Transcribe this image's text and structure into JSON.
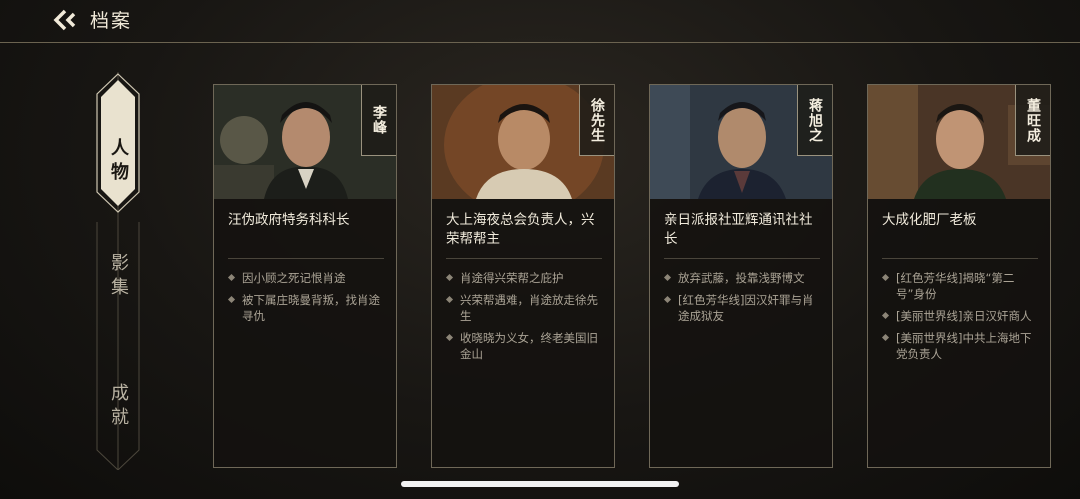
{
  "header": {
    "title": "档案",
    "back_icon": "double-chevron-left-icon"
  },
  "tabs": [
    {
      "label": "人物",
      "active": true
    },
    {
      "label": "影集",
      "active": false
    },
    {
      "label": "成就",
      "active": false
    }
  ],
  "characters": [
    {
      "name": "李峰",
      "role": "汪伪政府特务科科长",
      "details": [
        "因小顾之死记恨肖途",
        "被下属庄晓曼背叛，找肖途寻仇"
      ]
    },
    {
      "name": "徐先生",
      "role": "大上海夜总会负责人，兴荣帮帮主",
      "details": [
        "肖途得兴荣帮之庇护",
        "兴荣帮遇难，肖途放走徐先生",
        "收晓晓为义女，终老美国旧金山"
      ]
    },
    {
      "name": "蒋旭之",
      "role": "亲日派报社亚辉通讯社社长",
      "details": [
        "放弃武藤，投靠浅野博文",
        "[红色芳华线]因汉奸罪与肖途成狱友"
      ]
    },
    {
      "name": "董旺成",
      "role": "大成化肥厂老板",
      "details": [
        "[红色芳华线]揭晓“第二号”身份",
        "[美丽世界线]亲日汉奸商人",
        "[美丽世界线]中共上海地下党负责人"
      ]
    }
  ],
  "colors": {
    "accent": "#e8e1cf",
    "border": "#6f6858",
    "background": "#181613"
  }
}
